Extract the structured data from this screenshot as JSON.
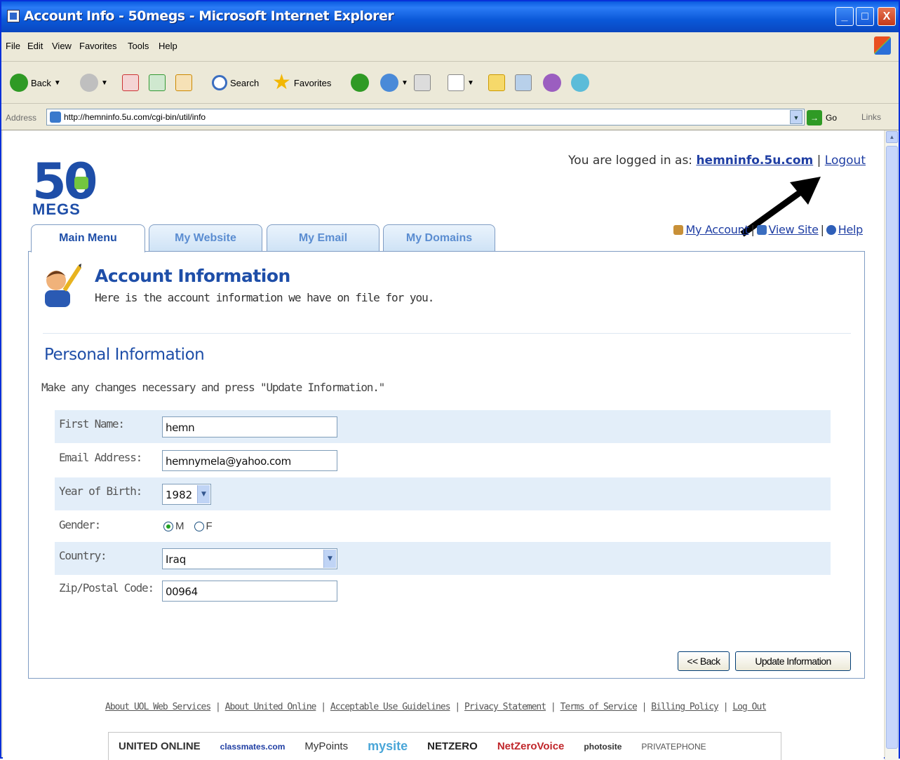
{
  "window": {
    "title": "Account Info - 50megs - Microsoft Internet Explorer",
    "min": "_",
    "max": "□",
    "close": "X"
  },
  "menubar": [
    "File",
    "Edit",
    "View",
    "Favorites",
    "Tools",
    "Help"
  ],
  "toolbar": {
    "back": "Back",
    "search": "Search",
    "favorites": "Favorites"
  },
  "address": {
    "label": "Address",
    "url": "http://hemninfo.5u.com/cgi-bin/util/info",
    "go": "Go",
    "links": "Links"
  },
  "header": {
    "logo_top": "50",
    "logo_bottom": "MEGS",
    "logged_in_prefix": "You are logged in as:",
    "username": "hemninfo.5u.com",
    "separator": "|",
    "logout": "Logout",
    "my_account": "My Account",
    "view_site": "View Site",
    "help": "Help"
  },
  "tabs": [
    {
      "label": "Main Menu",
      "active": true
    },
    {
      "label": "My Website",
      "active": false
    },
    {
      "label": "My Email",
      "active": false
    },
    {
      "label": "My Domains",
      "active": false
    }
  ],
  "panel": {
    "title": "Account Information",
    "subtitle": "Here is the account information we have on file for you.",
    "section_title": "Personal Information",
    "instructions": "Make any changes necessary and press \"Update Information.\""
  },
  "form": {
    "first_name": {
      "label": "First Name:",
      "value": "hemn"
    },
    "email": {
      "label": "Email Address:",
      "value": "hemnymela@yahoo.com"
    },
    "year_of_birth": {
      "label": "Year of Birth:",
      "value": "1982"
    },
    "gender": {
      "label": "Gender:",
      "option_m": "M",
      "option_f": "F",
      "selected": "M"
    },
    "country": {
      "label": "Country:",
      "value": "Iraq"
    },
    "zip": {
      "label": "Zip/Postal Code:",
      "value": "00964"
    }
  },
  "buttons": {
    "back": "<< Back",
    "update": "Update Information"
  },
  "footer": {
    "links": [
      "About UOL Web Services",
      "About United Online",
      "Acceptable Use Guidelines",
      "Privacy Statement",
      "Terms of Service",
      "Billing Policy",
      "Log Out"
    ],
    "brands": [
      "UNITED ONLINE",
      "classmates.com",
      "MyPoints",
      "mysite",
      "NETZERO",
      "NetZeroVoice",
      "photosite",
      "PRIVATEPHONE"
    ]
  },
  "colors": {
    "accent": "#1e4ea8",
    "row_shade": "#e3eef9",
    "xp_title": "#0a58d8"
  }
}
